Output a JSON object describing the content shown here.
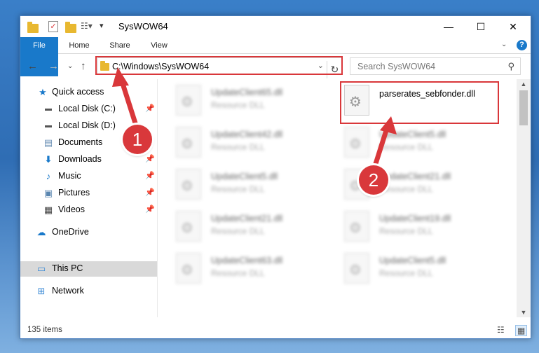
{
  "window": {
    "title": "SysWOW64",
    "minimize": "—",
    "maximize": "☐",
    "close": "✕"
  },
  "ribbon": {
    "tabs": [
      "File",
      "Home",
      "Share",
      "View"
    ],
    "help": "?"
  },
  "address": {
    "path": "C:\\Windows\\SysWOW64",
    "search_placeholder": "Search SysWOW64"
  },
  "nav_pane": {
    "items": [
      {
        "label": "Quick access",
        "icon": "star-icon"
      },
      {
        "label": "Local Disk (C:)",
        "icon": "drive-icon"
      },
      {
        "label": "Local Disk (D:)",
        "icon": "drive-icon"
      },
      {
        "label": "Documents",
        "icon": "documents-icon"
      },
      {
        "label": "Downloads",
        "icon": "download-icon"
      },
      {
        "label": "Music",
        "icon": "music-icon"
      },
      {
        "label": "Pictures",
        "icon": "pictures-icon"
      },
      {
        "label": "Videos",
        "icon": "videos-icon"
      },
      {
        "label": "OneDrive",
        "icon": "cloud-icon"
      },
      {
        "label": "This PC",
        "icon": "computer-icon"
      },
      {
        "label": "Network",
        "icon": "network-icon"
      }
    ]
  },
  "files": [
    {
      "name": "UpdateClient65.dll",
      "type": "Resource DLL"
    },
    {
      "name": "parserates_sebfonder.dll",
      "type": ""
    },
    {
      "name": "UpdateClient42.dll",
      "type": "Resource DLL"
    },
    {
      "name": "UpdateClient5.dll",
      "type": "Resource DLL"
    },
    {
      "name": "UpdateClient5.dll",
      "type": "Resource DLL"
    },
    {
      "name": "UpdateClient21.dll",
      "type": "Resource DLL"
    },
    {
      "name": "UpdateClient21.dll",
      "type": "Resource DLL"
    },
    {
      "name": "UpdateClient19.dll",
      "type": "Resource DLL"
    },
    {
      "name": "UpdateClient63.dll",
      "type": "Resource DLL"
    },
    {
      "name": "UpdateClient5.dll",
      "type": "Resource DLL"
    }
  ],
  "status": {
    "item_count": "135 items"
  },
  "annotations": {
    "step1": "1",
    "step2": "2",
    "color": "#d9373a"
  }
}
